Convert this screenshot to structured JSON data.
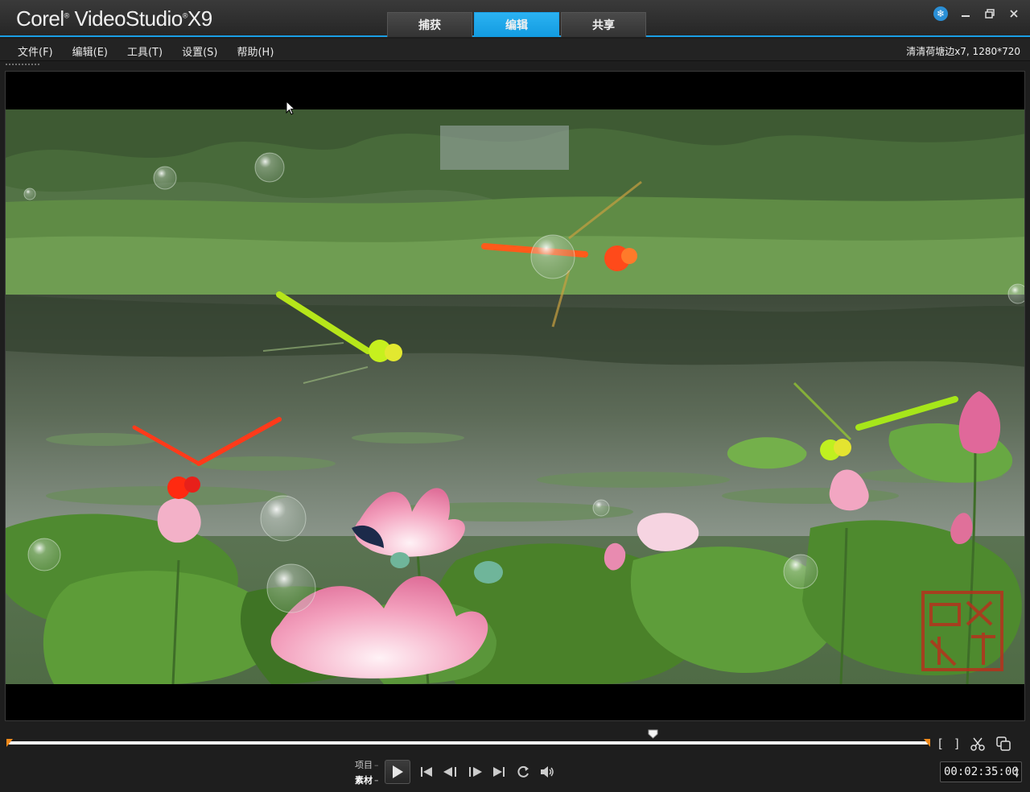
{
  "app": {
    "brand": "Corel",
    "product": "VideoStudio",
    "version": "X9"
  },
  "tabs": [
    {
      "label": "捕获",
      "active": false
    },
    {
      "label": "编辑",
      "active": true
    },
    {
      "label": "共享",
      "active": false
    }
  ],
  "menu": [
    {
      "label": "文件(F)"
    },
    {
      "label": "编辑(E)"
    },
    {
      "label": "工具(T)"
    },
    {
      "label": "设置(S)"
    },
    {
      "label": "帮助(H)"
    }
  ],
  "project_info": "清清荷塘边x7, 1280*720",
  "playback": {
    "mode_project": "项目",
    "mode_clip": "素材",
    "selected_mode": "素材",
    "timecode": "00:02:35:00",
    "playhead_position": 0.7
  },
  "colors": {
    "accent": "#1aa0e8",
    "trim_marker": "#f28a1a",
    "background": "#1e1e1e"
  },
  "icons": [
    "snowflake-icon",
    "minimize-icon",
    "restore-icon",
    "close-icon",
    "play-icon",
    "go-to-start-icon",
    "previous-frame-icon",
    "next-frame-icon",
    "go-to-end-icon",
    "repeat-icon",
    "volume-icon",
    "mark-in-icon",
    "mark-out-icon",
    "split-clip-icon",
    "enlarge-preview-icon"
  ]
}
